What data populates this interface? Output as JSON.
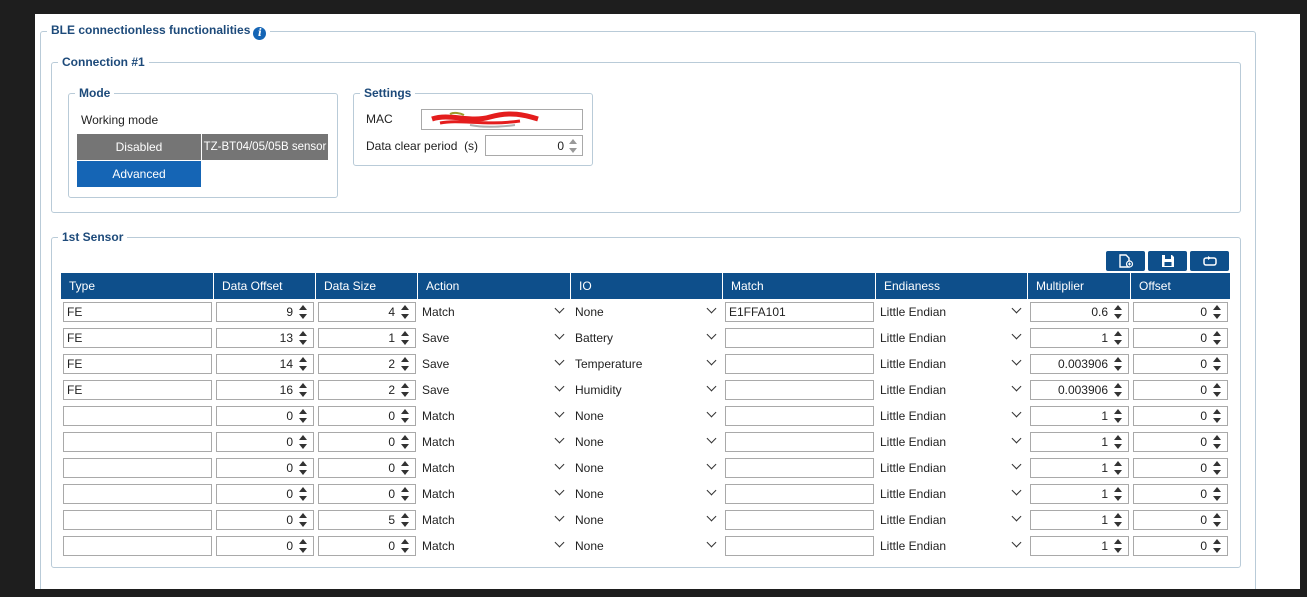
{
  "main_group": {
    "title": "BLE connectionless functionalities",
    "info_icon": "info-icon"
  },
  "connection": {
    "title": "Connection #1",
    "mode": {
      "title": "Mode",
      "working_mode_label": "Working mode",
      "buttons": [
        {
          "label": "Disabled",
          "color": "#757575"
        },
        {
          "label": "TZ-BT04/05/05B sensor",
          "color": "#757575"
        },
        {
          "label": "Advanced",
          "color": "#1565b5",
          "selected": true
        }
      ]
    },
    "settings": {
      "title": "Settings",
      "mac_label": "MAC",
      "data_clear_label": "Data clear period",
      "data_clear_unit": "(s)",
      "data_clear_value": "0"
    }
  },
  "sensor": {
    "title": "1st Sensor",
    "toolbar_icons": [
      "new-file-icon",
      "save-icon",
      "reload-icon"
    ],
    "columns": [
      "Type",
      "Data Offset",
      "Data Size",
      "Action",
      "IO",
      "Match",
      "Endianess",
      "Multiplier",
      "Offset"
    ],
    "rows": [
      {
        "type": "FE",
        "data_offset": "9",
        "data_size": "4",
        "action": "Match",
        "io": "None",
        "match": "E1FFA101",
        "endianess": "Little Endian",
        "multiplier": "0.6",
        "offset": "0"
      },
      {
        "type": "FE",
        "data_offset": "13",
        "data_size": "1",
        "action": "Save",
        "io": "Battery",
        "match": "",
        "endianess": "Little Endian",
        "multiplier": "1",
        "offset": "0"
      },
      {
        "type": "FE",
        "data_offset": "14",
        "data_size": "2",
        "action": "Save",
        "io": "Temperature",
        "match": "",
        "endianess": "Little Endian",
        "multiplier": "0.003906",
        "offset": "0"
      },
      {
        "type": "FE",
        "data_offset": "16",
        "data_size": "2",
        "action": "Save",
        "io": "Humidity",
        "match": "",
        "endianess": "Little Endian",
        "multiplier": "0.003906",
        "offset": "0"
      },
      {
        "type": "",
        "data_offset": "0",
        "data_size": "0",
        "action": "Match",
        "io": "None",
        "match": "",
        "endianess": "Little Endian",
        "multiplier": "1",
        "offset": "0"
      },
      {
        "type": "",
        "data_offset": "0",
        "data_size": "0",
        "action": "Match",
        "io": "None",
        "match": "",
        "endianess": "Little Endian",
        "multiplier": "1",
        "offset": "0"
      },
      {
        "type": "",
        "data_offset": "0",
        "data_size": "0",
        "action": "Match",
        "io": "None",
        "match": "",
        "endianess": "Little Endian",
        "multiplier": "1",
        "offset": "0"
      },
      {
        "type": "",
        "data_offset": "0",
        "data_size": "0",
        "action": "Match",
        "io": "None",
        "match": "",
        "endianess": "Little Endian",
        "multiplier": "1",
        "offset": "0"
      },
      {
        "type": "",
        "data_offset": "0",
        "data_size": "5",
        "action": "Match",
        "io": "None",
        "match": "",
        "endianess": "Little Endian",
        "multiplier": "1",
        "offset": "0"
      },
      {
        "type": "",
        "data_offset": "0",
        "data_size": "0",
        "action": "Match",
        "io": "None",
        "match": "",
        "endianess": "Little Endian",
        "multiplier": "1",
        "offset": "0"
      }
    ]
  },
  "colors": {
    "header_bg": "#0e4f8b",
    "accent": "#1565b5",
    "legend_text": "#1d4a7a",
    "page_bg": "#1e1e1e"
  }
}
